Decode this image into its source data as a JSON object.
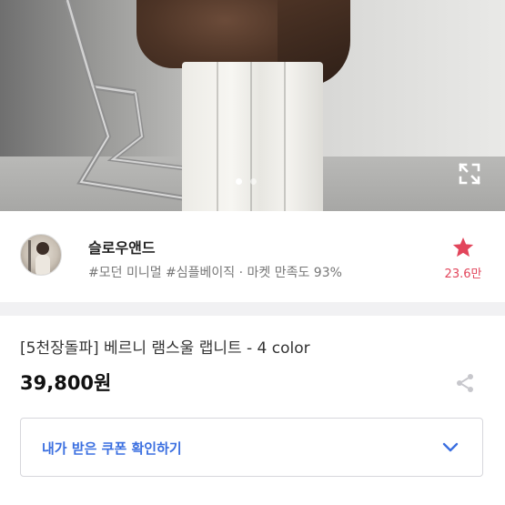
{
  "gallery": {
    "dots": [
      {
        "active": true
      },
      {
        "active": false
      }
    ],
    "expand_icon": "expand-icon"
  },
  "seller": {
    "name": "슬로우앤드",
    "tags": "#모던 미니멀 #심플베이직 · 마켓 만족도 93%",
    "favorite_count": "23.6만",
    "favorite_icon": "star-icon",
    "accent_color": "#e2455b"
  },
  "product": {
    "title": "[5천장돌파] 베르니 램스울 랩니트 - 4 color",
    "price": "39,800원",
    "share_icon": "share-icon"
  },
  "coupon": {
    "label": "내가 받은 쿠폰 확인하기",
    "chevron_icon": "chevron-down-icon",
    "color": "#3b6fe0"
  }
}
